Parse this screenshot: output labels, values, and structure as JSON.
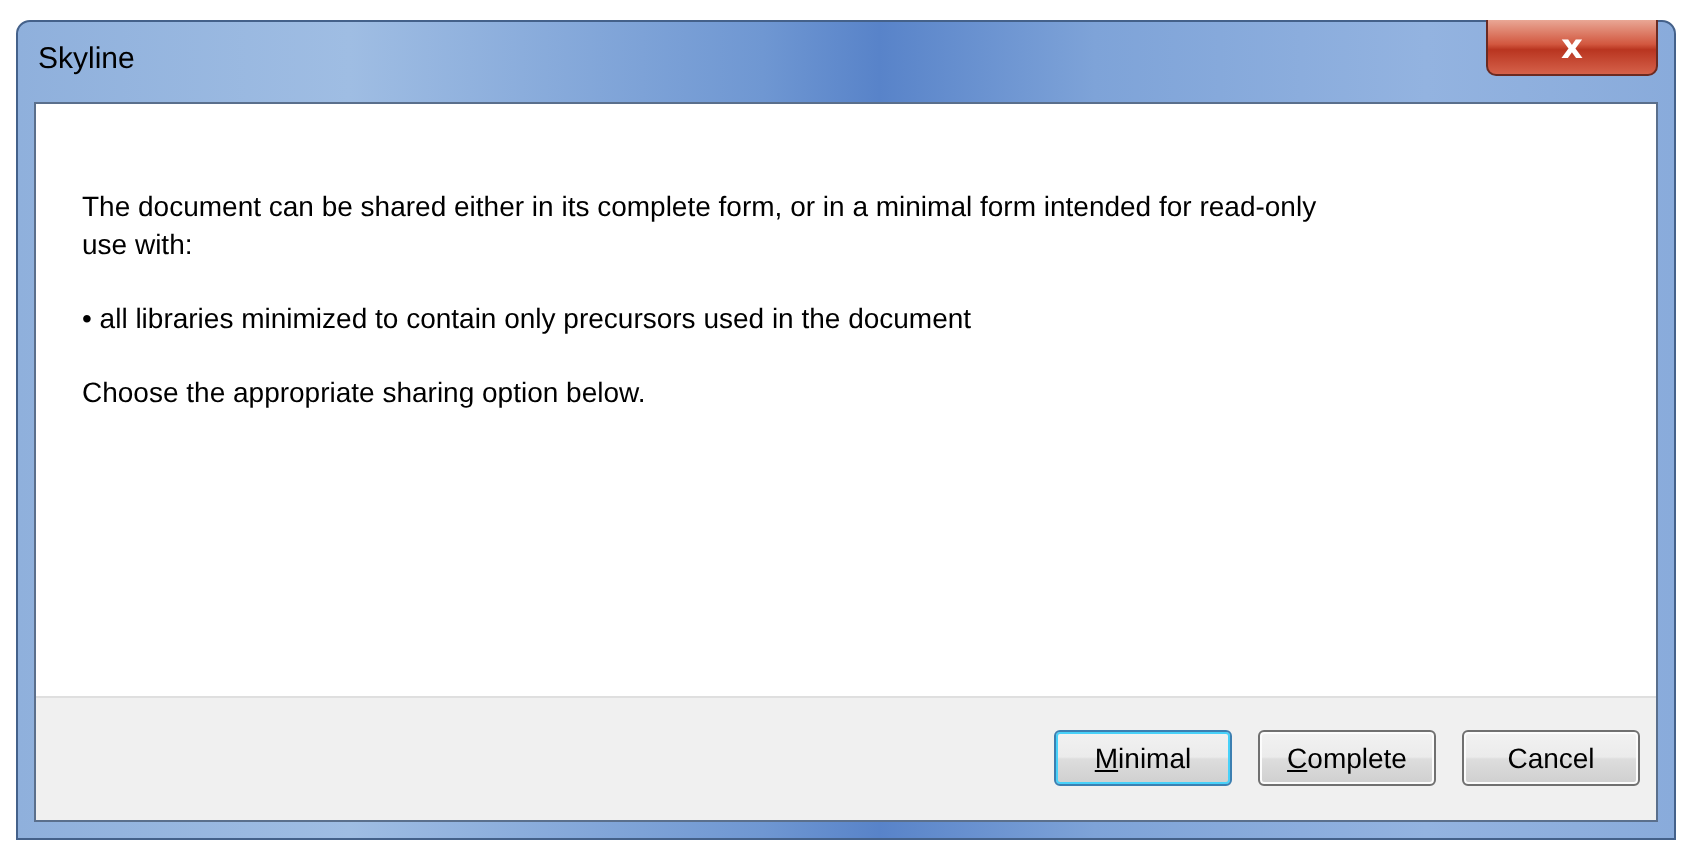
{
  "window": {
    "title": "Skyline",
    "close_label": "x"
  },
  "message": {
    "lines": [
      "The document can be shared either in its complete form, or in a minimal form intended for read-only use with:"
    ],
    "bullets": [
      {
        "marker": "•",
        "text": "all libraries minimized to contain only precursors used in the document"
      }
    ],
    "footer": "Choose the appropriate sharing option below."
  },
  "buttons": [
    {
      "label": "Minimal",
      "mnemonic": true,
      "default": true
    },
    {
      "label": "Complete",
      "mnemonic": true,
      "default": false
    },
    {
      "label": "Cancel",
      "mnemonic": false,
      "default": false
    }
  ]
}
